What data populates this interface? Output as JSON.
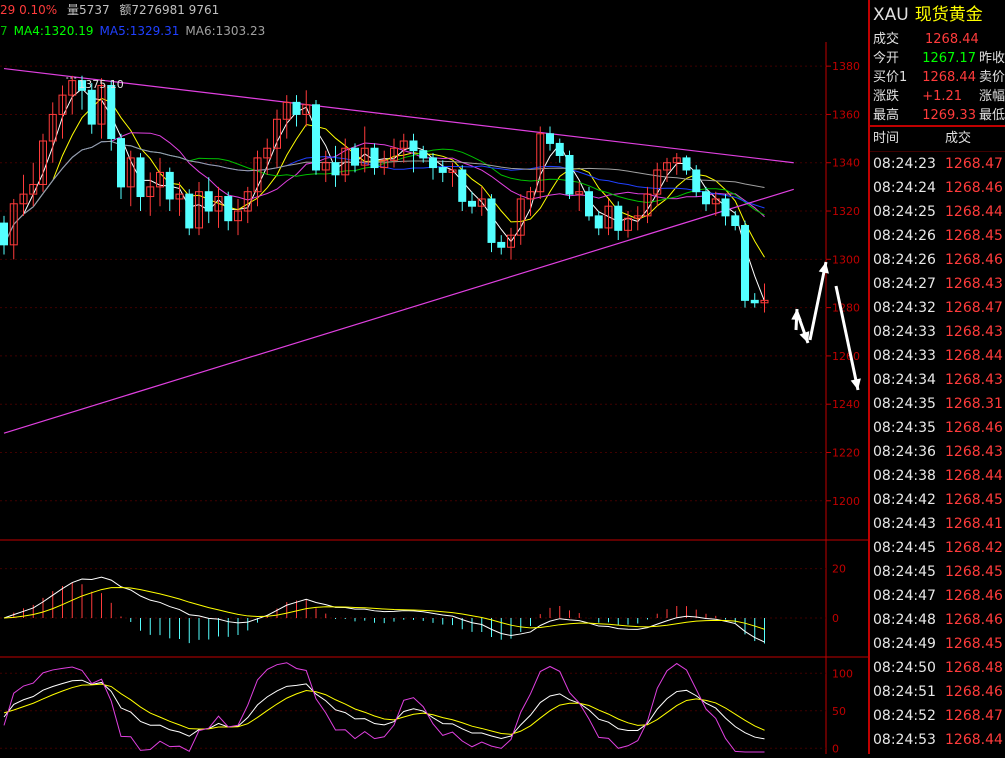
{
  "header": {
    "change": "29 0.10%",
    "volume": "量5737",
    "amount": "额7276981 9761",
    "ma_items": [
      {
        "text": "7",
        "color": "#00c000"
      },
      {
        "text": "MA4:1320.19",
        "color": "#00ff00"
      },
      {
        "text": "MA5:1329.31",
        "color": "#2040ff"
      },
      {
        "text": "MA6:1303.23",
        "color": "#a0a0a0"
      }
    ]
  },
  "quote": {
    "symbol": "XAU",
    "name": "现货黄金",
    "rows": [
      {
        "label": "成交",
        "value": "1268.44",
        "value_color": "#ff3b3b",
        "label2": ""
      },
      {
        "label": "今开",
        "value": "1267.17",
        "value_color": "#00ff00",
        "label2": "昨收"
      },
      {
        "label": "买价1",
        "value": "1268.44",
        "value_color": "#ff3b3b",
        "label2": "卖价"
      },
      {
        "label": "涨跌",
        "value": "+1.21",
        "value_color": "#ff3b3b",
        "label2": "涨幅"
      },
      {
        "label": "最高",
        "value": "1269.33",
        "value_color": "#ff3b3b",
        "label2": "最低"
      }
    ],
    "ticks_header": {
      "time": "时间",
      "price": "成交"
    },
    "ticks": [
      {
        "time": "08:24:23",
        "price": "1268.47"
      },
      {
        "time": "08:24:24",
        "price": "1268.46"
      },
      {
        "time": "08:24:25",
        "price": "1268.44"
      },
      {
        "time": "08:24:26",
        "price": "1268.45"
      },
      {
        "time": "08:24:26",
        "price": "1268.46"
      },
      {
        "time": "08:24:27",
        "price": "1268.43"
      },
      {
        "time": "08:24:32",
        "price": "1268.47"
      },
      {
        "time": "08:24:33",
        "price": "1268.43"
      },
      {
        "time": "08:24:33",
        "price": "1268.44"
      },
      {
        "time": "08:24:34",
        "price": "1268.43"
      },
      {
        "time": "08:24:35",
        "price": "1268.31"
      },
      {
        "time": "08:24:35",
        "price": "1268.46"
      },
      {
        "time": "08:24:36",
        "price": "1268.43"
      },
      {
        "time": "08:24:38",
        "price": "1268.44"
      },
      {
        "time": "08:24:42",
        "price": "1268.45"
      },
      {
        "time": "08:24:43",
        "price": "1268.41"
      },
      {
        "time": "08:24:45",
        "price": "1268.42"
      },
      {
        "time": "08:24:45",
        "price": "1268.45"
      },
      {
        "time": "08:24:47",
        "price": "1268.46"
      },
      {
        "time": "08:24:48",
        "price": "1268.46"
      },
      {
        "time": "08:24:49",
        "price": "1268.45"
      },
      {
        "time": "08:24:50",
        "price": "1268.48"
      },
      {
        "time": "08:24:51",
        "price": "1268.46"
      },
      {
        "time": "08:24:52",
        "price": "1268.47"
      },
      {
        "time": "08:24:53",
        "price": "1268.44"
      }
    ]
  },
  "chart_data": [
    {
      "type": "candlestick",
      "ylim": [
        1185,
        1390
      ],
      "y_ticks": [
        1380,
        1360,
        1340,
        1320,
        1300,
        1280,
        1260,
        1240,
        1220,
        1200
      ],
      "y_tick_labels": [
        "1380",
        "1360",
        "1340",
        "1320",
        "1300",
        "1280",
        "1260",
        "1240",
        "1220",
        "1200"
      ],
      "annotation": "1375.10",
      "annotation_value": 1375.1,
      "up_color": "#ff3b3b",
      "down_color": "#54ffff",
      "candles": [
        [
          1315,
          1318,
          1302,
          1306
        ],
        [
          1306,
          1325,
          1300,
          1323
        ],
        [
          1323,
          1335,
          1318,
          1327
        ],
        [
          1327,
          1340,
          1322,
          1331
        ],
        [
          1331,
          1352,
          1328,
          1349
        ],
        [
          1349,
          1365,
          1340,
          1360
        ],
        [
          1360,
          1372,
          1350,
          1368
        ],
        [
          1368,
          1376,
          1360,
          1374
        ],
        [
          1374,
          1376,
          1362,
          1370
        ],
        [
          1370,
          1373,
          1352,
          1356
        ],
        [
          1356,
          1375,
          1350,
          1372
        ],
        [
          1372,
          1374,
          1345,
          1350
        ],
        [
          1350,
          1352,
          1325,
          1330
        ],
        [
          1330,
          1345,
          1322,
          1342
        ],
        [
          1342,
          1344,
          1320,
          1326
        ],
        [
          1326,
          1336,
          1318,
          1330
        ],
        [
          1330,
          1342,
          1322,
          1336
        ],
        [
          1336,
          1338,
          1320,
          1325
        ],
        [
          1325,
          1332,
          1318,
          1327
        ],
        [
          1327,
          1329,
          1310,
          1313
        ],
        [
          1313,
          1332,
          1310,
          1328
        ],
        [
          1328,
          1334,
          1315,
          1320
        ],
        [
          1320,
          1330,
          1313,
          1326
        ],
        [
          1326,
          1328,
          1312,
          1316
        ],
        [
          1316,
          1325,
          1310,
          1320
        ],
        [
          1320,
          1330,
          1315,
          1328
        ],
        [
          1328,
          1345,
          1322,
          1342
        ],
        [
          1342,
          1350,
          1335,
          1346
        ],
        [
          1346,
          1362,
          1338,
          1358
        ],
        [
          1358,
          1368,
          1350,
          1365
        ],
        [
          1365,
          1368,
          1355,
          1360
        ],
        [
          1360,
          1370,
          1355,
          1364
        ],
        [
          1364,
          1366,
          1335,
          1337
        ],
        [
          1337,
          1345,
          1332,
          1340
        ],
        [
          1340,
          1347,
          1330,
          1335
        ],
        [
          1335,
          1350,
          1332,
          1346
        ],
        [
          1346,
          1348,
          1336,
          1339
        ],
        [
          1339,
          1355,
          1336,
          1346
        ],
        [
          1346,
          1348,
          1335,
          1338
        ],
        [
          1338,
          1345,
          1335,
          1341
        ],
        [
          1341,
          1350,
          1338,
          1346
        ],
        [
          1346,
          1352,
          1340,
          1349
        ],
        [
          1349,
          1352,
          1336,
          1345
        ],
        [
          1345,
          1347,
          1340,
          1342
        ],
        [
          1342,
          1344,
          1333,
          1338
        ],
        [
          1338,
          1341,
          1332,
          1336
        ],
        [
          1336,
          1340,
          1330,
          1337
        ],
        [
          1337,
          1339,
          1320,
          1324
        ],
        [
          1324,
          1328,
          1319,
          1322
        ],
        [
          1322,
          1330,
          1318,
          1325
        ],
        [
          1325,
          1327,
          1303,
          1307
        ],
        [
          1307,
          1310,
          1302,
          1305
        ],
        [
          1305,
          1313,
          1300,
          1310
        ],
        [
          1310,
          1327,
          1306,
          1325
        ],
        [
          1325,
          1330,
          1318,
          1328
        ],
        [
          1328,
          1355,
          1325,
          1352
        ],
        [
          1352,
          1355,
          1345,
          1348
        ],
        [
          1348,
          1350,
          1340,
          1343
        ],
        [
          1343,
          1345,
          1325,
          1327
        ],
        [
          1327,
          1332,
          1320,
          1328
        ],
        [
          1328,
          1330,
          1316,
          1318
        ],
        [
          1318,
          1320,
          1310,
          1313
        ],
        [
          1313,
          1325,
          1310,
          1322
        ],
        [
          1322,
          1324,
          1308,
          1312
        ],
        [
          1312,
          1320,
          1309,
          1317
        ],
        [
          1317,
          1322,
          1312,
          1318
        ],
        [
          1318,
          1330,
          1315,
          1327
        ],
        [
          1327,
          1340,
          1322,
          1337
        ],
        [
          1337,
          1342,
          1332,
          1340
        ],
        [
          1340,
          1344,
          1335,
          1342
        ],
        [
          1342,
          1343,
          1335,
          1337
        ],
        [
          1337,
          1339,
          1326,
          1328
        ],
        [
          1328,
          1330,
          1320,
          1323
        ],
        [
          1323,
          1328,
          1318,
          1325
        ],
        [
          1325,
          1327,
          1314,
          1318
        ],
        [
          1318,
          1320,
          1312,
          1314
        ],
        [
          1314,
          1316,
          1280,
          1283
        ],
        [
          1283,
          1286,
          1280,
          1282
        ],
        [
          1282,
          1290,
          1278,
          1283
        ]
      ],
      "trendlines": [
        {
          "name": "upper-trendline",
          "color": "#e040e0",
          "from": [
            0,
            1379
          ],
          "to": [
            81,
            1340
          ]
        },
        {
          "name": "lower-trendline",
          "color": "#e040e0",
          "from": [
            0,
            1228
          ],
          "to": [
            81,
            1329
          ]
        }
      ]
    },
    {
      "type": "macd",
      "ylim": [
        -15,
        30
      ],
      "y_ticks": [
        20,
        0
      ],
      "y_tick_labels": [
        "20",
        "0"
      ],
      "bar_up_color": "#ff3b3b",
      "bar_down_color": "#54ffff"
    },
    {
      "type": "oscillator",
      "ylim": [
        -5,
        115
      ],
      "y_ticks": [
        100,
        50,
        0
      ],
      "y_tick_labels": [
        "100",
        "50",
        "0"
      ]
    }
  ]
}
